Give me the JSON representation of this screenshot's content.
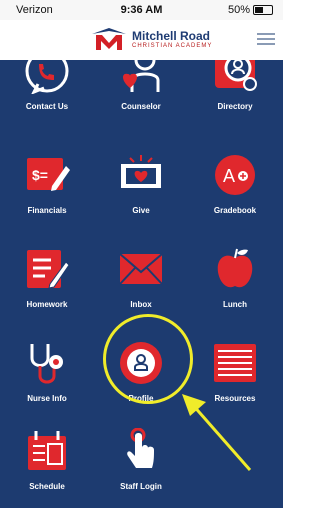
{
  "status_bar": {
    "carrier": "Verizon",
    "time": "9:36 AM",
    "battery": "50%"
  },
  "header": {
    "logo_name": "Mitchell Road",
    "logo_sub": "CHRISTIAN ACADEMY"
  },
  "tiles": [
    {
      "label": "Contact Us",
      "icon": "phone-bubble-icon"
    },
    {
      "label": "Counselor",
      "icon": "heart-person-icon"
    },
    {
      "label": "Directory",
      "icon": "directory-icon"
    },
    {
      "label": "Financials",
      "icon": "financials-icon"
    },
    {
      "label": "Give",
      "icon": "give-heart-icon"
    },
    {
      "label": "Gradebook",
      "icon": "gradebook-icon"
    },
    {
      "label": "Homework",
      "icon": "homework-icon"
    },
    {
      "label": "Inbox",
      "icon": "envelope-icon"
    },
    {
      "label": "Lunch",
      "icon": "apple-icon"
    },
    {
      "label": "Nurse Info",
      "icon": "stethoscope-icon"
    },
    {
      "label": "Profile",
      "icon": "profile-icon"
    },
    {
      "label": "Resources",
      "icon": "resources-icon"
    },
    {
      "label": "Schedule",
      "icon": "calendar-icon"
    },
    {
      "label": "Staff Login",
      "icon": "hand-tap-icon"
    }
  ],
  "colors": {
    "background": "#1d3b70",
    "accent": "#e0282d",
    "highlight": "#f0ec2a"
  }
}
